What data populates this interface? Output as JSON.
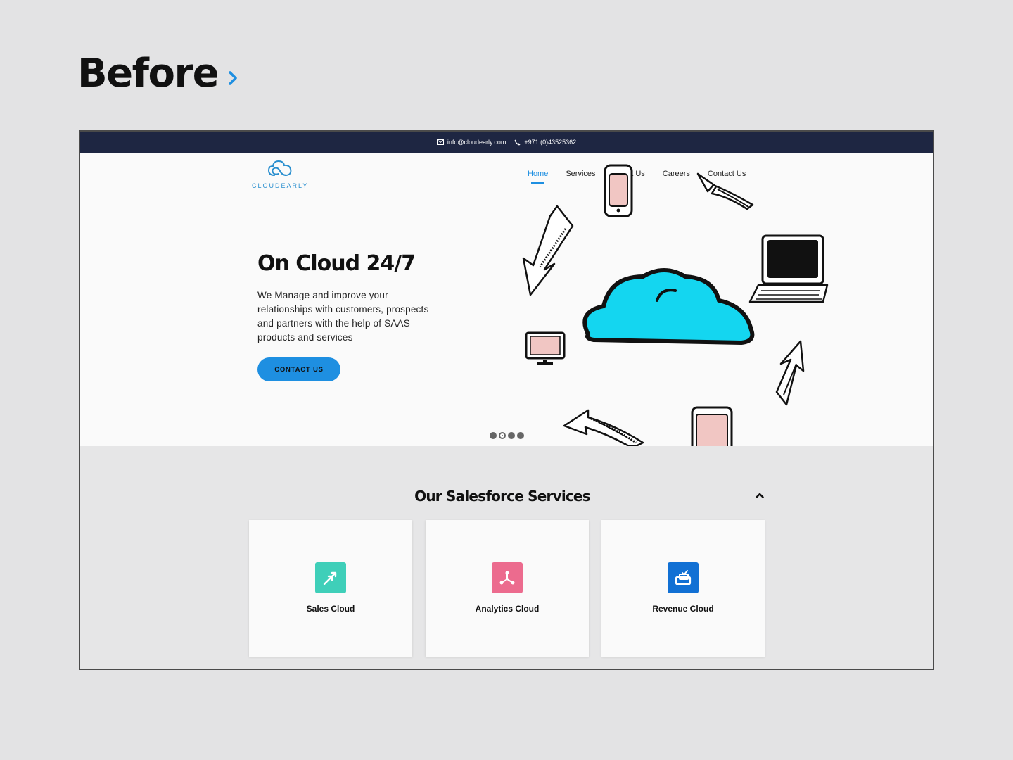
{
  "heading": {
    "title": "Before"
  },
  "topbar": {
    "email": "info@cloudearly.com",
    "phone": "+971 (0)43525362"
  },
  "logo": {
    "text": "CLOUDEARLY"
  },
  "nav": {
    "items": [
      {
        "label": "Home",
        "active": true
      },
      {
        "label": "Services"
      },
      {
        "label": "About Us"
      },
      {
        "label": "Careers"
      },
      {
        "label": "Contact Us"
      }
    ]
  },
  "hero": {
    "title": "On Cloud 24/7",
    "description": "We Manage and improve your relationships with customers, prospects and partners with the help of SAAS products and services",
    "cta_label": "CONTACT US",
    "slider": {
      "count": 4,
      "active_index": 1
    }
  },
  "services": {
    "title": "Our Salesforce Services",
    "cards": [
      {
        "label": "Sales Cloud",
        "icon": "sales-cloud-icon",
        "color": "#3fcfb9"
      },
      {
        "label": "Analytics Cloud",
        "icon": "analytics-cloud-icon",
        "color": "#ec6b8e"
      },
      {
        "label": "Revenue Cloud",
        "icon": "revenue-cloud-icon",
        "color": "#1170d4"
      }
    ]
  },
  "colors": {
    "accent": "#1e8fe1",
    "topbar": "#1e2642",
    "page_background": "#e3e3e4"
  }
}
